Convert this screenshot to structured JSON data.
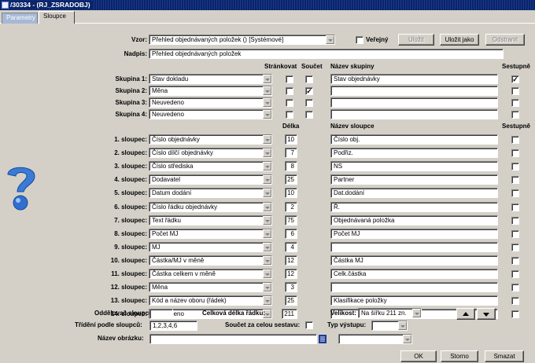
{
  "window": {
    "title": "/30334 - (RJ_ZSRADOBJ)"
  },
  "tabs": [
    {
      "label": "Parametry"
    },
    {
      "label": "Sloupce"
    }
  ],
  "top": {
    "vzor_label": "Vzor:",
    "vzor_value": "Přehled objednávaných položek  ()  [Systémové]",
    "verejny_label": "Veřejný",
    "ulozit": "Uložit",
    "ulozit_jako": "Uložit jako",
    "odstranit": "Odstranit",
    "nadpis_label": "Nadpis:",
    "nadpis_value": "Přehled objednávaných položek"
  },
  "group_headers": {
    "strankovat": "Stránkovat",
    "soucet": "Součet",
    "nazev_skupiny": "Název skupiny",
    "sestupne": "Sestupně"
  },
  "groups": [
    {
      "label": "Skupina 1:",
      "value": "Stav dokladu",
      "strankovat": false,
      "soucet": false,
      "nazev": "Stav objednávky",
      "sestupne": true
    },
    {
      "label": "Skupina 2:",
      "value": "Měna",
      "strankovat": false,
      "soucet": true,
      "nazev": "",
      "sestupne": false
    },
    {
      "label": "Skupina 3:",
      "value": "Neuvedeno",
      "strankovat": false,
      "soucet": false,
      "nazev": "",
      "sestupne": false
    },
    {
      "label": "Skupina 4:",
      "value": "Neuvedeno",
      "strankovat": false,
      "soucet": false,
      "nazev": "",
      "sestupne": false
    }
  ],
  "column_headers": {
    "delka": "Délka",
    "nazev_sloupce": "Název sloupce",
    "sestupne": "Sestupně"
  },
  "columns": [
    {
      "label": "1. sloupec:",
      "value": "Číslo objednávky",
      "delka": "10",
      "nazev": "Číslo obj."
    },
    {
      "label": "2. sloupec:",
      "value": "Číslo dílčí objednávky",
      "delka": "7",
      "nazev": "Podřiz."
    },
    {
      "label": "3. sloupec:",
      "value": "Číslo střediska",
      "delka": "8",
      "nazev": "NS"
    },
    {
      "label": "4. sloupec:",
      "value": "Dodavatel",
      "delka": "25",
      "nazev": "Partner"
    },
    {
      "label": "5. sloupec:",
      "value": "Datum dodání",
      "delka": "10",
      "nazev": "Dat.dodání"
    },
    {
      "label": "6. sloupec:",
      "value": "Číslo řádku objednávky",
      "delka": "2",
      "nazev": "Ř."
    },
    {
      "label": "7. sloupec:",
      "value": "Text řádku",
      "delka": "75",
      "nazev": "Objednávaná položka"
    },
    {
      "label": "8. sloupec:",
      "value": "Počet MJ",
      "delka": "6",
      "nazev": "Počet MJ"
    },
    {
      "label": "9. sloupec:",
      "value": "MJ",
      "delka": "4",
      "nazev": ""
    },
    {
      "label": "10. sloupec:",
      "value": "Částka/MJ v měně",
      "delka": "12",
      "nazev": "Částka MJ"
    },
    {
      "label": "11. sloupec:",
      "value": "Částka celkem v měně",
      "delka": "12",
      "nazev": "Celk.částka"
    },
    {
      "label": "12. sloupec:",
      "value": "Měna",
      "delka": "3",
      "nazev": ""
    },
    {
      "label": "13. sloupec:",
      "value": "Kód a název oboru (řádek)",
      "delka": "25",
      "nazev": "Klasifikace položky"
    },
    {
      "label": "14. sloupec:",
      "value": "Neuvedeno",
      "delka": "",
      "nazev": ""
    }
  ],
  "bottom": {
    "oddelovac_label": "Oddělovač sloupců:",
    "oddelovac_value": "",
    "celkova_label": "Celková délka řádku:",
    "celkova_value": "211",
    "velikost_label": "Velikost:",
    "velikost_value": "Na šířku 211 zn.",
    "trideni_label": "Třídění podle sloupců:",
    "trideni_value": "1,2,3,4,6",
    "soucet_label": "Součet za celou sestavu:",
    "typ_label": "Typ výstupu:",
    "typ_value": "",
    "obrazek_label": "Název obrázku:",
    "obrazek_value": "",
    "obrazek_combo": "",
    "ok": "OK",
    "storno": "Storno",
    "smazat": "Smazat"
  },
  "colors": {
    "titlebar": "#0a246a",
    "background": "#d4d0c8",
    "help_icon": "#3a7bd5"
  },
  "icons": {
    "up": "arrow-up-icon",
    "down": "arrow-down-icon",
    "help": "help-question-icon",
    "list": "list-icon"
  }
}
